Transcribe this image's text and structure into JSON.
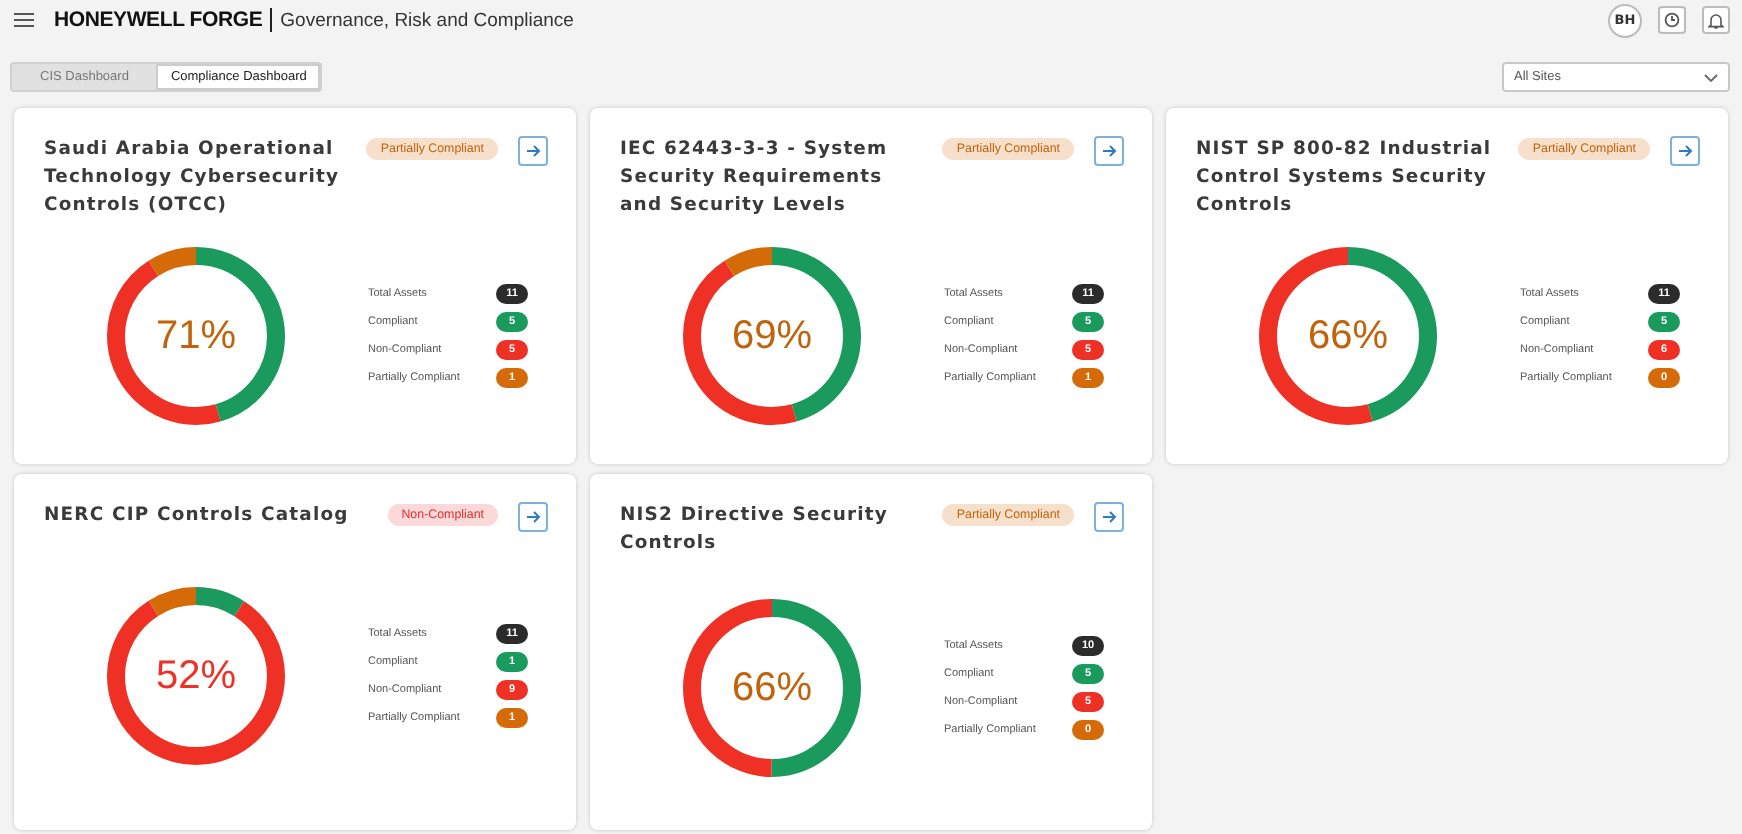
{
  "header": {
    "brand": "HONEYWELL FORGE",
    "app_title": "Governance, Risk and Compliance",
    "avatar": "BH"
  },
  "tabs": [
    {
      "label": "CIS Dashboard",
      "selected": false
    },
    {
      "label": "Compliance Dashboard",
      "selected": true
    }
  ],
  "site_filter": {
    "value": "All Sites"
  },
  "cards": [
    {
      "title": "Saudi Arabia Operational Technology Cybersecurity Controls (OTCC)",
      "status": {
        "label": "Partially Compliant",
        "kind": "partial"
      },
      "percent": "71%",
      "stats": [
        {
          "label": "Total Assets",
          "value": "11",
          "kind": "total"
        },
        {
          "label": "Compliant",
          "value": "5",
          "kind": "compliant"
        },
        {
          "label": "Non-Compliant",
          "value": "5",
          "kind": "non_compliant"
        },
        {
          "label": "Partially Compliant",
          "value": "1",
          "kind": "partial"
        }
      ]
    },
    {
      "title": "IEC 62443-3-3 - System Security Requirements and Security Levels",
      "status": {
        "label": "Partially Compliant",
        "kind": "partial"
      },
      "percent": "69%",
      "stats": [
        {
          "label": "Total Assets",
          "value": "11",
          "kind": "total"
        },
        {
          "label": "Compliant",
          "value": "5",
          "kind": "compliant"
        },
        {
          "label": "Non-Compliant",
          "value": "5",
          "kind": "non_compliant"
        },
        {
          "label": "Partially Compliant",
          "value": "1",
          "kind": "partial"
        }
      ]
    },
    {
      "title": "NIST SP 800-82 Industrial Control Systems Security Controls",
      "status": {
        "label": "Partially Compliant",
        "kind": "partial"
      },
      "percent": "66%",
      "stats": [
        {
          "label": "Total Assets",
          "value": "11",
          "kind": "total"
        },
        {
          "label": "Compliant",
          "value": "5",
          "kind": "compliant"
        },
        {
          "label": "Non-Compliant",
          "value": "6",
          "kind": "non_compliant"
        },
        {
          "label": "Partially Compliant",
          "value": "0",
          "kind": "partial"
        }
      ]
    },
    {
      "title": "NERC CIP Controls Catalog",
      "status": {
        "label": "Non-Compliant",
        "kind": "non_compliant"
      },
      "percent": "52%",
      "stats": [
        {
          "label": "Total Assets",
          "value": "11",
          "kind": "total"
        },
        {
          "label": "Compliant",
          "value": "1",
          "kind": "compliant"
        },
        {
          "label": "Non-Compliant",
          "value": "9",
          "kind": "non_compliant"
        },
        {
          "label": "Partially Compliant",
          "value": "1",
          "kind": "partial"
        }
      ]
    },
    {
      "title": "NIS2 Directive Security Controls",
      "status": {
        "label": "Partially Compliant",
        "kind": "partial"
      },
      "percent": "66%",
      "stats": [
        {
          "label": "Total Assets",
          "value": "10",
          "kind": "total"
        },
        {
          "label": "Compliant",
          "value": "5",
          "kind": "compliant"
        },
        {
          "label": "Non-Compliant",
          "value": "5",
          "kind": "non_compliant"
        },
        {
          "label": "Partially Compliant",
          "value": "0",
          "kind": "partial"
        }
      ]
    }
  ]
}
